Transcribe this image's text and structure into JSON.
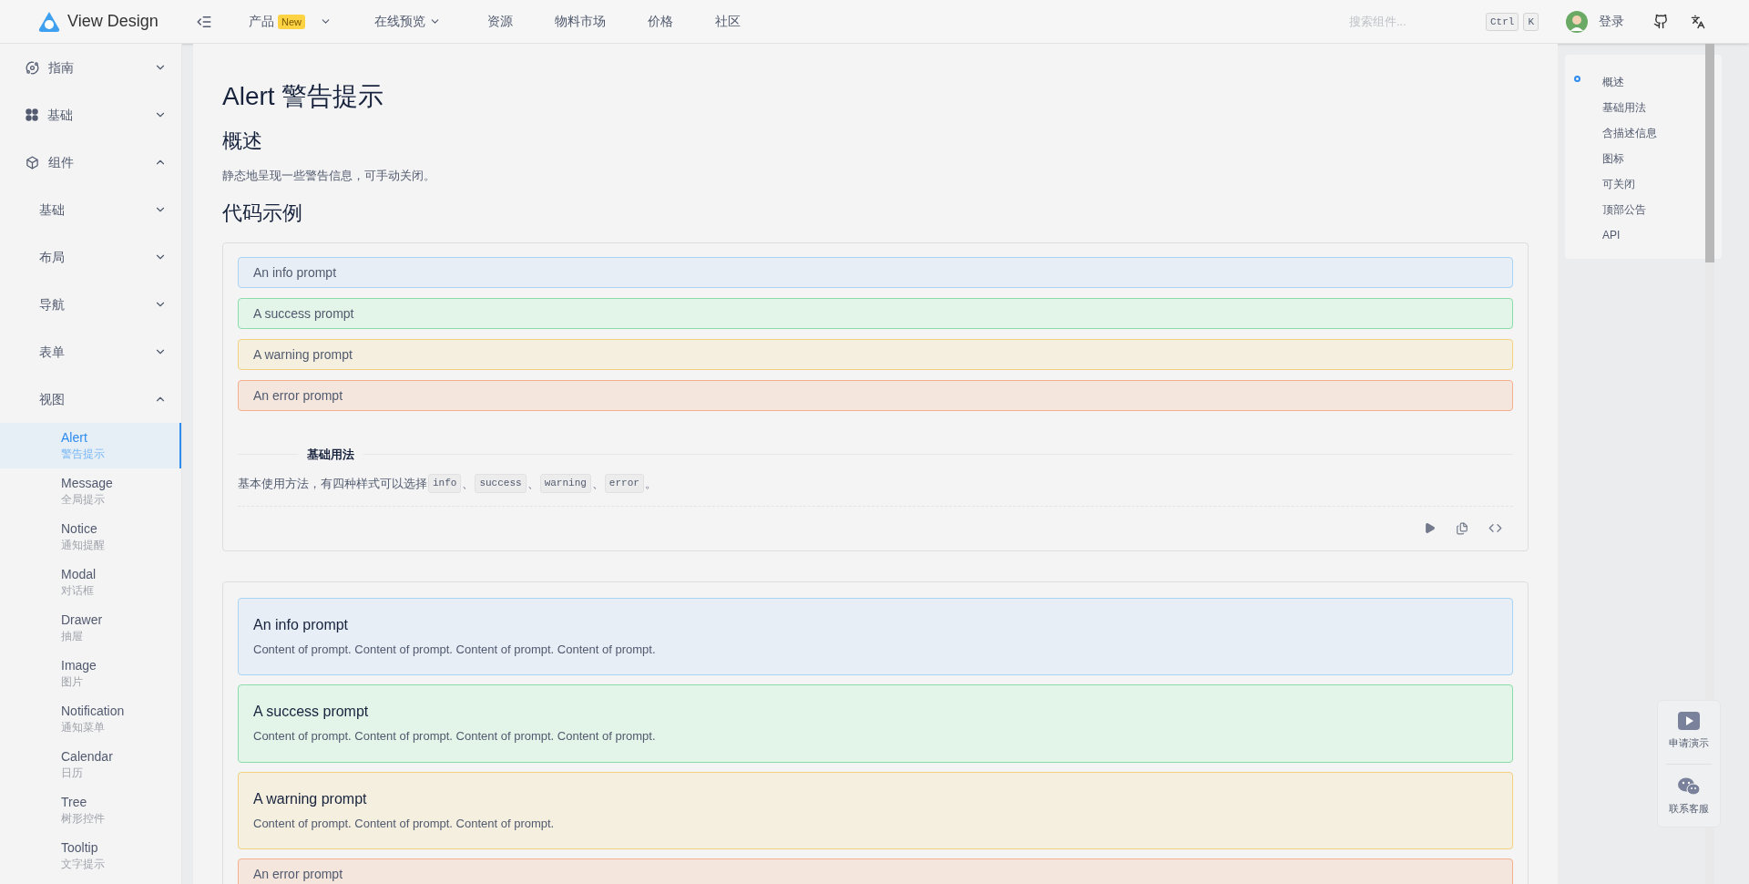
{
  "header": {
    "logo": "View Design",
    "nav": [
      {
        "label": "产品",
        "badge": "New",
        "dropdown": true
      },
      {
        "label": "在线预览",
        "dropdown": true
      },
      {
        "label": "资源",
        "dropdown": false
      },
      {
        "label": "物料市场",
        "dropdown": false
      },
      {
        "label": "价格",
        "dropdown": false
      },
      {
        "label": "社区",
        "dropdown": false
      }
    ],
    "search": {
      "placeholder": "搜索组件..."
    },
    "keys": [
      "Ctrl",
      "K"
    ],
    "login": "登录"
  },
  "sidebar": {
    "items": [
      {
        "label": "指南",
        "kind": "planet",
        "expanded": false
      },
      {
        "label": "基础",
        "kind": "clover",
        "expanded": false
      },
      {
        "label": "组件",
        "kind": "cube",
        "expanded": true,
        "children": [
          {
            "label": "基础",
            "expanded": false
          },
          {
            "label": "布局",
            "expanded": false
          },
          {
            "label": "导航",
            "expanded": false
          },
          {
            "label": "表单",
            "expanded": false
          },
          {
            "label": "视图",
            "expanded": true,
            "children": [
              {
                "label": "Alert",
                "subtitle": "警告提示",
                "selected": true
              },
              {
                "label": "Message",
                "subtitle": "全局提示",
                "selected": false
              },
              {
                "label": "Notice",
                "subtitle": "通知提醒",
                "selected": false
              },
              {
                "label": "Modal",
                "subtitle": "对话框",
                "selected": false
              },
              {
                "label": "Drawer",
                "subtitle": "抽屉",
                "selected": false
              },
              {
                "label": "Image",
                "subtitle": "图片",
                "selected": false
              },
              {
                "label": "Notification",
                "subtitle": "通知菜单",
                "selected": false
              },
              {
                "label": "Calendar",
                "subtitle": "日历",
                "selected": false
              },
              {
                "label": "Tree",
                "subtitle": "树形控件",
                "selected": false
              },
              {
                "label": "Tooltip",
                "subtitle": "文字提示",
                "selected": false
              }
            ]
          }
        ]
      }
    ]
  },
  "content": {
    "title": "Alert 警告提示",
    "overview_heading": "概述",
    "overview": "静态地呈现一些警告信息，可手动关闭。",
    "examples_heading": "代码示例",
    "demos": [
      {
        "alerts": [
          {
            "kind": "info",
            "title": "An info prompt"
          },
          {
            "kind": "success",
            "title": "A success prompt"
          },
          {
            "kind": "warning",
            "title": "A warning prompt"
          },
          {
            "kind": "error",
            "title": "An error prompt"
          }
        ],
        "section_title": "基础用法",
        "description": [
          {
            "kind": "text",
            "text": "基本使用方法，有四种样式可以选择"
          },
          {
            "kind": "code",
            "text": "info"
          },
          {
            "kind": "text",
            "text": "、"
          },
          {
            "kind": "code",
            "text": "success"
          },
          {
            "kind": "text",
            "text": "、"
          },
          {
            "kind": "code",
            "text": "warning"
          },
          {
            "kind": "text",
            "text": "、"
          },
          {
            "kind": "code",
            "text": "error"
          },
          {
            "kind": "text",
            "text": "。"
          }
        ]
      },
      {
        "alerts": [
          {
            "kind": "info",
            "title": "An info prompt",
            "desc": "Content of prompt. Content of prompt. Content of prompt. Content of prompt."
          },
          {
            "kind": "success",
            "title": "A success prompt",
            "desc": "Content of prompt. Content of prompt. Content of prompt. Content of prompt."
          },
          {
            "kind": "warning",
            "title": "A warning prompt",
            "desc": "Content of prompt. Content of prompt. Content of prompt."
          },
          {
            "kind": "error",
            "title": "An error prompt"
          }
        ]
      }
    ]
  },
  "toc": {
    "items": [
      {
        "label": "概述",
        "selected": true
      },
      {
        "label": "基础用法",
        "selected": false
      },
      {
        "label": "含描述信息",
        "selected": false
      },
      {
        "label": "图标",
        "selected": false
      },
      {
        "label": "可关闭",
        "selected": false
      },
      {
        "label": "顶部公告",
        "selected": false
      },
      {
        "label": "API",
        "selected": false
      }
    ]
  },
  "float_actions": [
    {
      "kind": "video",
      "label": "申请演示"
    },
    {
      "kind": "chat",
      "label": "联系客服"
    }
  ]
}
